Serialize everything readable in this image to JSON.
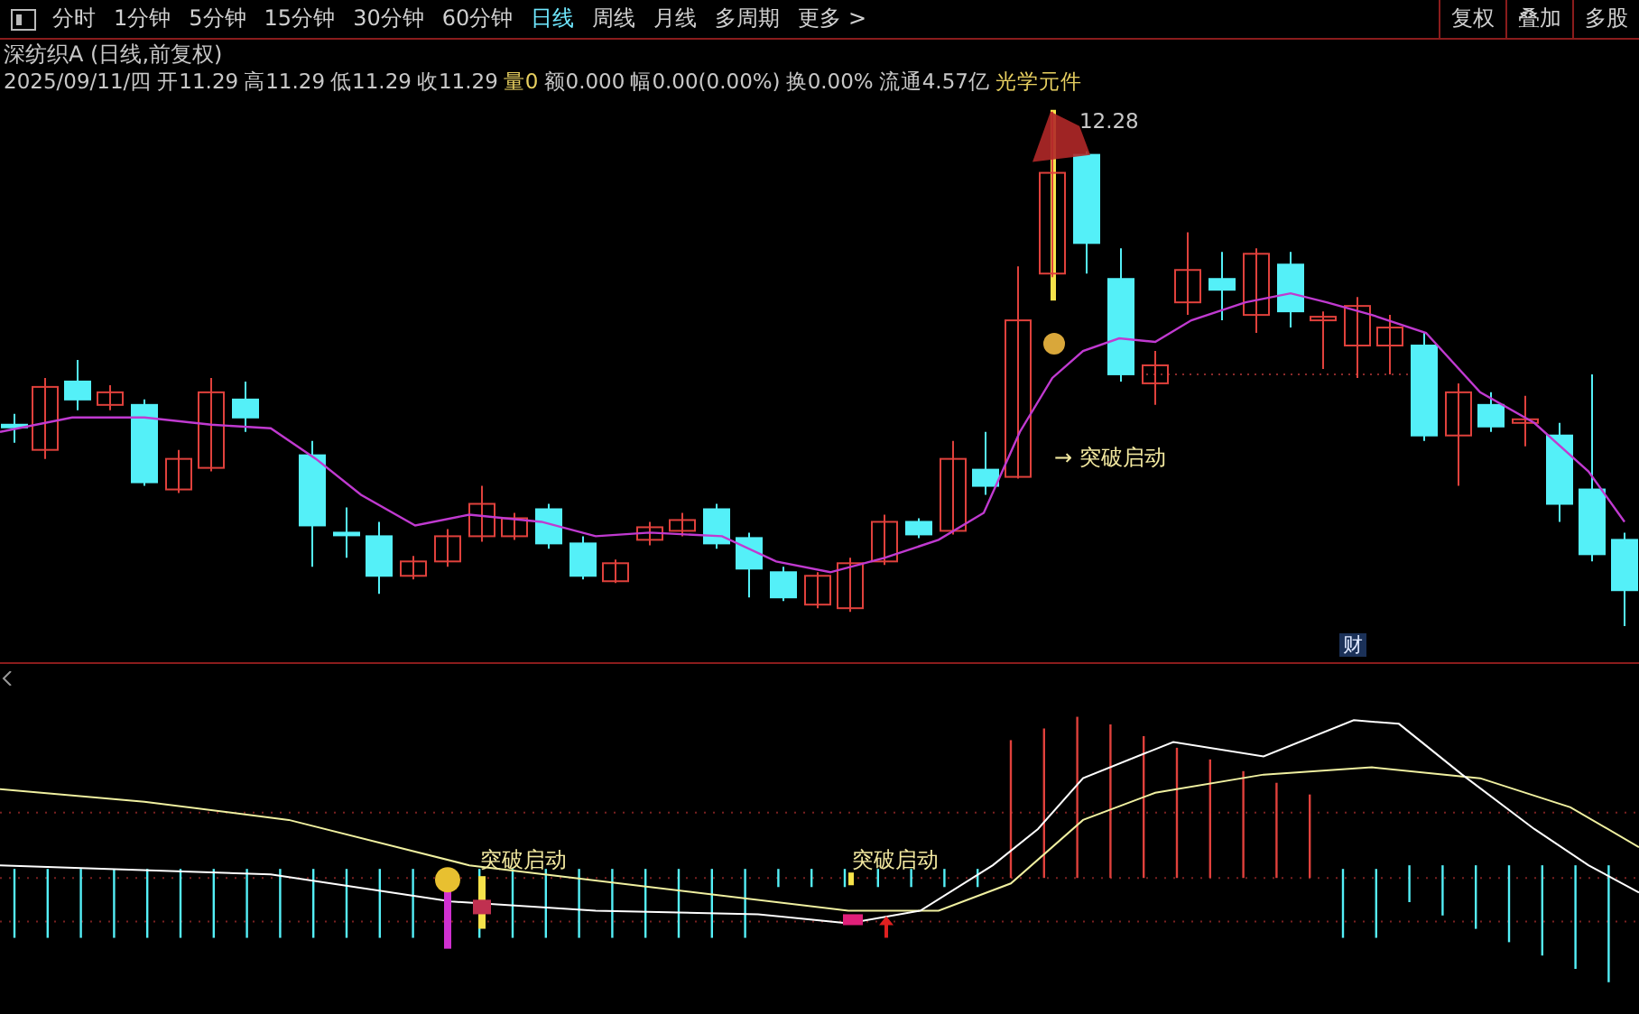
{
  "toolbar": {
    "periods": [
      {
        "label": "分时",
        "selected": false
      },
      {
        "label": "1分钟",
        "selected": false
      },
      {
        "label": "5分钟",
        "selected": false
      },
      {
        "label": "15分钟",
        "selected": false
      },
      {
        "label": "30分钟",
        "selected": false
      },
      {
        "label": "60分钟",
        "selected": false
      },
      {
        "label": "日线",
        "selected": true
      },
      {
        "label": "周线",
        "selected": false
      },
      {
        "label": "月线",
        "selected": false
      },
      {
        "label": "多周期",
        "selected": false
      },
      {
        "label": "更多 >",
        "selected": false
      }
    ],
    "actions": [
      "复权",
      "叠加",
      "多股"
    ]
  },
  "stock": {
    "title": "深纺织A (日线,前复权)",
    "quote": [
      {
        "text": "2025/09/11/四",
        "kind": "plain"
      },
      {
        "text": "开11.29",
        "kind": "plain"
      },
      {
        "text": "高11.29",
        "kind": "plain"
      },
      {
        "text": "低11.29",
        "kind": "plain"
      },
      {
        "text": "收11.29",
        "kind": "plain"
      },
      {
        "text": "量0",
        "kind": "volume"
      },
      {
        "text": "额0.000",
        "kind": "plain"
      },
      {
        "text": "幅0.00(0.00%)",
        "kind": "plain"
      },
      {
        "text": "换0.00%",
        "kind": "plain"
      },
      {
        "text": "流通4.57亿",
        "kind": "plain"
      },
      {
        "text": "光学元件",
        "kind": "sector"
      }
    ]
  },
  "price_chart": {
    "high_label": "12.28",
    "signal_label": "→ 突破启动",
    "finance_badge": "财"
  },
  "indicator": {
    "signals": [
      {
        "label": "突破启动"
      },
      {
        "label": "突破启动"
      }
    ]
  }
}
